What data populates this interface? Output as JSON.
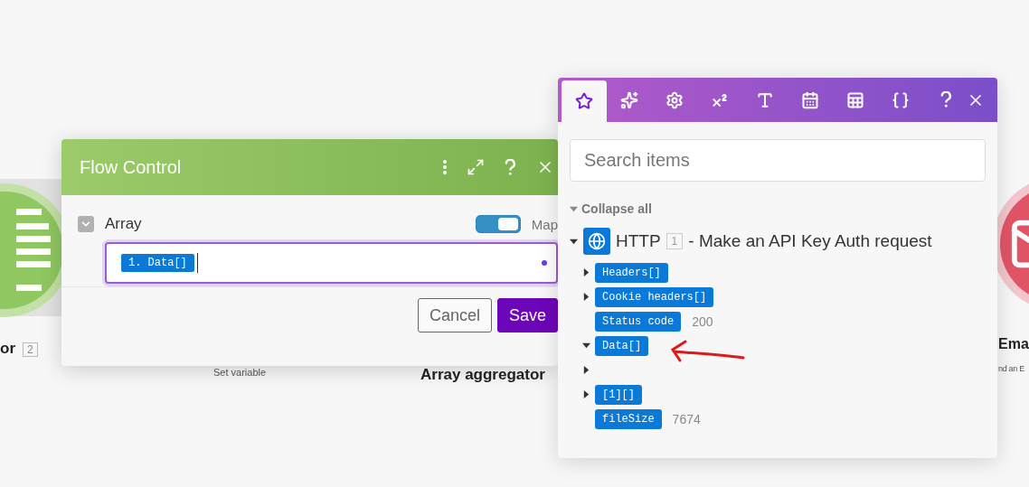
{
  "canvas": {
    "nodes": [
      {
        "kind": "green",
        "title": "or",
        "badge": "2"
      },
      {
        "kind": "caption",
        "subtitle": "Set variable"
      },
      {
        "kind": "title",
        "title": "Array aggregator"
      },
      {
        "kind": "red",
        "title": "Ema",
        "subtitle": "nd an E"
      }
    ]
  },
  "flow_control": {
    "title": "Flow Control",
    "field": {
      "label": "Array",
      "expanded": true,
      "map_toggle": {
        "label": "Map",
        "on": true
      },
      "token": "1. Data[]"
    },
    "buttons": [
      {
        "label": "Cancel",
        "kind": "secondary"
      },
      {
        "label": "Save",
        "kind": "primary"
      }
    ]
  },
  "mapping_panel": {
    "tabs": [
      {
        "selected": true
      },
      {
        "selected": false
      },
      {
        "selected": false
      },
      {
        "selected": false
      },
      {
        "selected": false
      },
      {
        "selected": false
      },
      {
        "selected": false
      },
      {
        "selected": false
      }
    ],
    "search": {
      "placeholder": "Search items"
    },
    "collapse_all": "Collapse all",
    "module": {
      "name": "HTTP",
      "badge": "1",
      "title": "- Make an API Key Auth request",
      "expanded": true
    },
    "items": [
      {
        "label": "Headers[]",
        "expanded": false
      },
      {
        "label": "Cookie headers[]",
        "expanded": false
      },
      {
        "label": "Status code",
        "value": "200"
      },
      {
        "label": "Data[]",
        "expanded": true
      },
      {
        "expanded": false
      },
      {
        "label": "[1][]",
        "expanded": false
      },
      {
        "label": "fileSize",
        "value": "7674"
      }
    ]
  }
}
